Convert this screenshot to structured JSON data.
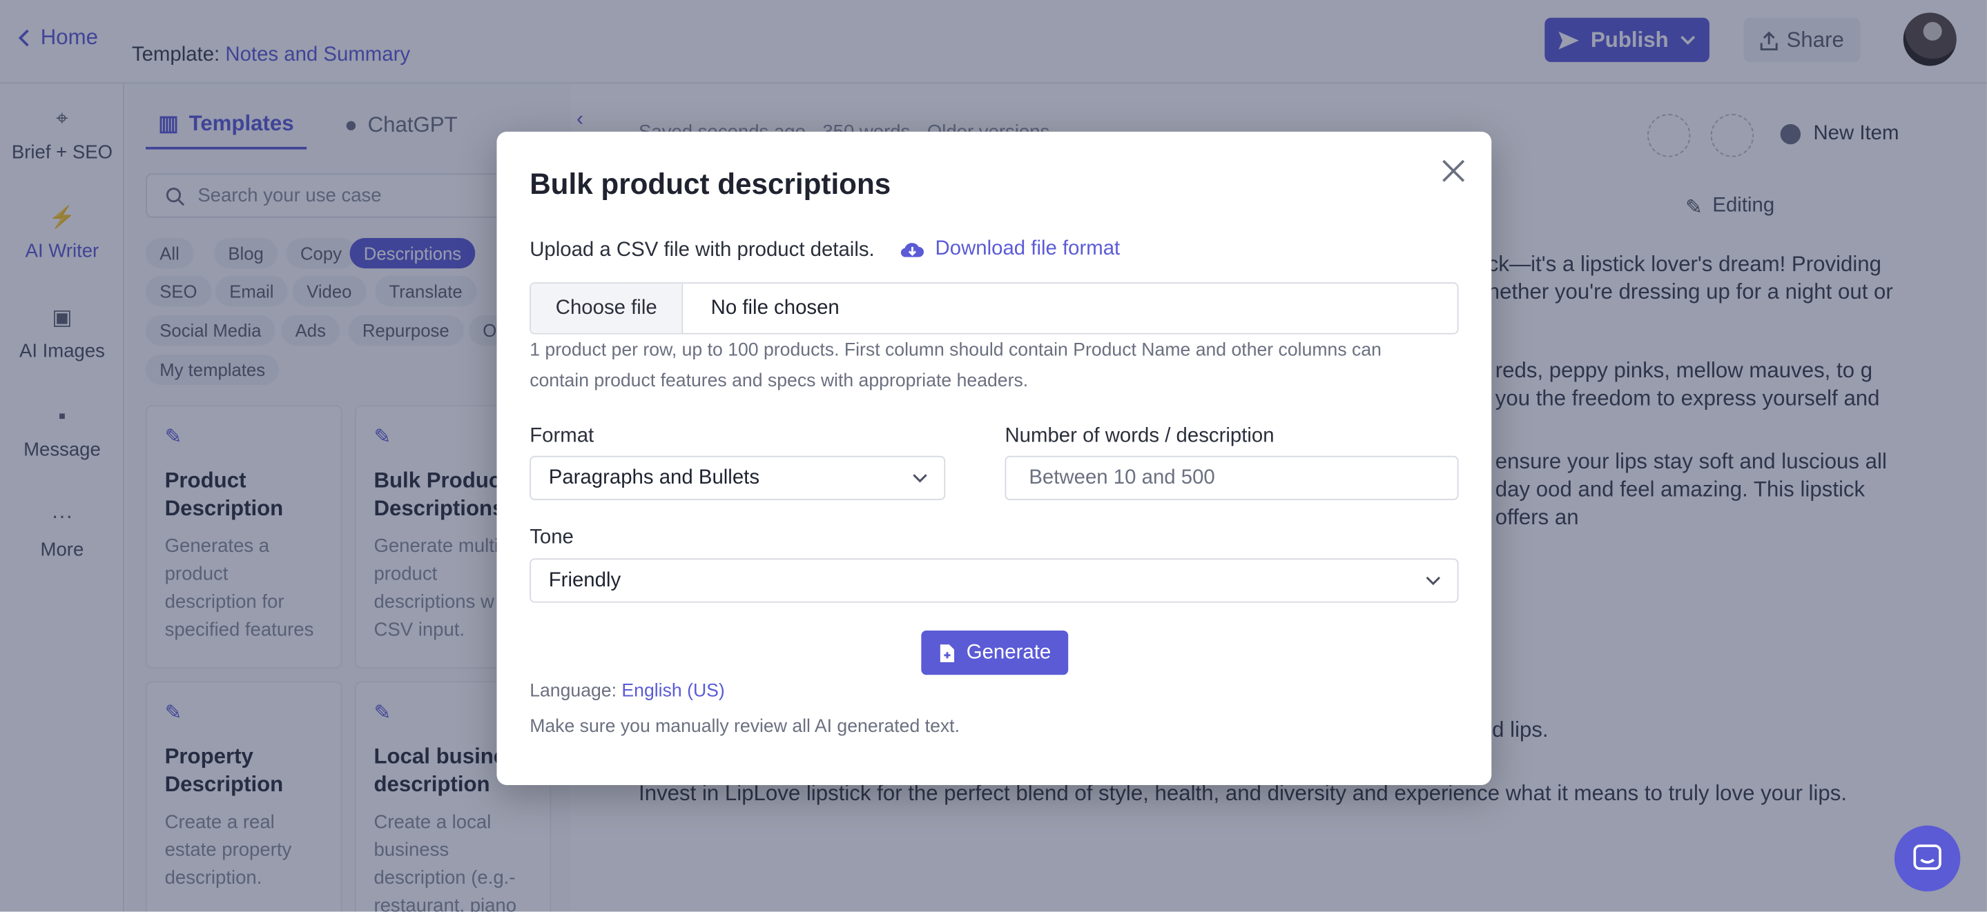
{
  "header": {
    "home_label": "Home",
    "template_prefix": "Template:",
    "template_name": "Notes and Summary",
    "publish_label": "Publish",
    "share_label": "Share"
  },
  "left_nav": {
    "items": [
      {
        "label": "Brief + SEO",
        "icon": "crosshair-icon"
      },
      {
        "label": "AI Writer",
        "icon": "bolt-icon"
      },
      {
        "label": "AI Images",
        "icon": "image-icon"
      },
      {
        "label": "Message",
        "icon": "message-icon"
      },
      {
        "label": "More",
        "icon": "more-icon"
      }
    ],
    "active": "AI Writer"
  },
  "templates_panel": {
    "tabs": [
      "Templates",
      "ChatGPT"
    ],
    "search_placeholder": "Search your use case",
    "chips": [
      "All",
      "Blog",
      "Copy",
      "Descriptions",
      "SEO",
      "Email",
      "Video",
      "Translate",
      "Social Media",
      "Ads",
      "Repurpose",
      "O",
      "My templates"
    ],
    "active_chip": "Descriptions",
    "cards": [
      {
        "title": "Product Description",
        "desc": "Generates a product description for specified features"
      },
      {
        "title": "Bulk Product Descriptions",
        "desc": "Generate multi product descriptions w CSV input."
      },
      {
        "title": "Property Description",
        "desc": "Create a real estate property description."
      },
      {
        "title": "Local business description",
        "desc": "Create a local business description (e.g.- restaurant, piano"
      }
    ]
  },
  "editor": {
    "meta": "Saved seconds ago · 350 words · Older versions",
    "new_item_label": "New Item",
    "editing_label": "Editing",
    "text": [
      "ck—it's a lipstick lover's dream! Providing hether you're dressing up for a night out or",
      "reds, peppy pinks, mellow mauves, to g you the freedom to express yourself and",
      "ensure your lips stay soft and luscious all day ood and feel amazing. This lipstick offers an",
      "- LipLove holds hydration at its core, ensuring not just beautiful, but also healthy, nourished lips.",
      "Invest in LipLove lipstick for the perfect blend of style, health, and diversity and experience what it means to truly love your lips."
    ]
  },
  "modal": {
    "title": "Bulk product descriptions",
    "upload_label": "Upload a CSV file with product details.",
    "download_label": "Download file format",
    "choose_file_label": "Choose file",
    "no_file_label": "No file chosen",
    "file_help": "1 product per row, up to 100 products. First column should contain Product Name and other columns can contain product features and specs with appropriate headers.",
    "format_label": "Format",
    "format_value": "Paragraphs and Bullets",
    "words_label": "Number of words / description",
    "words_placeholder": "Between 10 and 500",
    "tone_label": "Tone",
    "tone_value": "Friendly",
    "generate_label": "Generate",
    "language_prefix": "Language:",
    "language_value": "English (US)",
    "review_note": "Make sure you manually review all AI generated text."
  },
  "colors": {
    "accent": "#5b5bd6",
    "overlay": "#212a4d"
  }
}
